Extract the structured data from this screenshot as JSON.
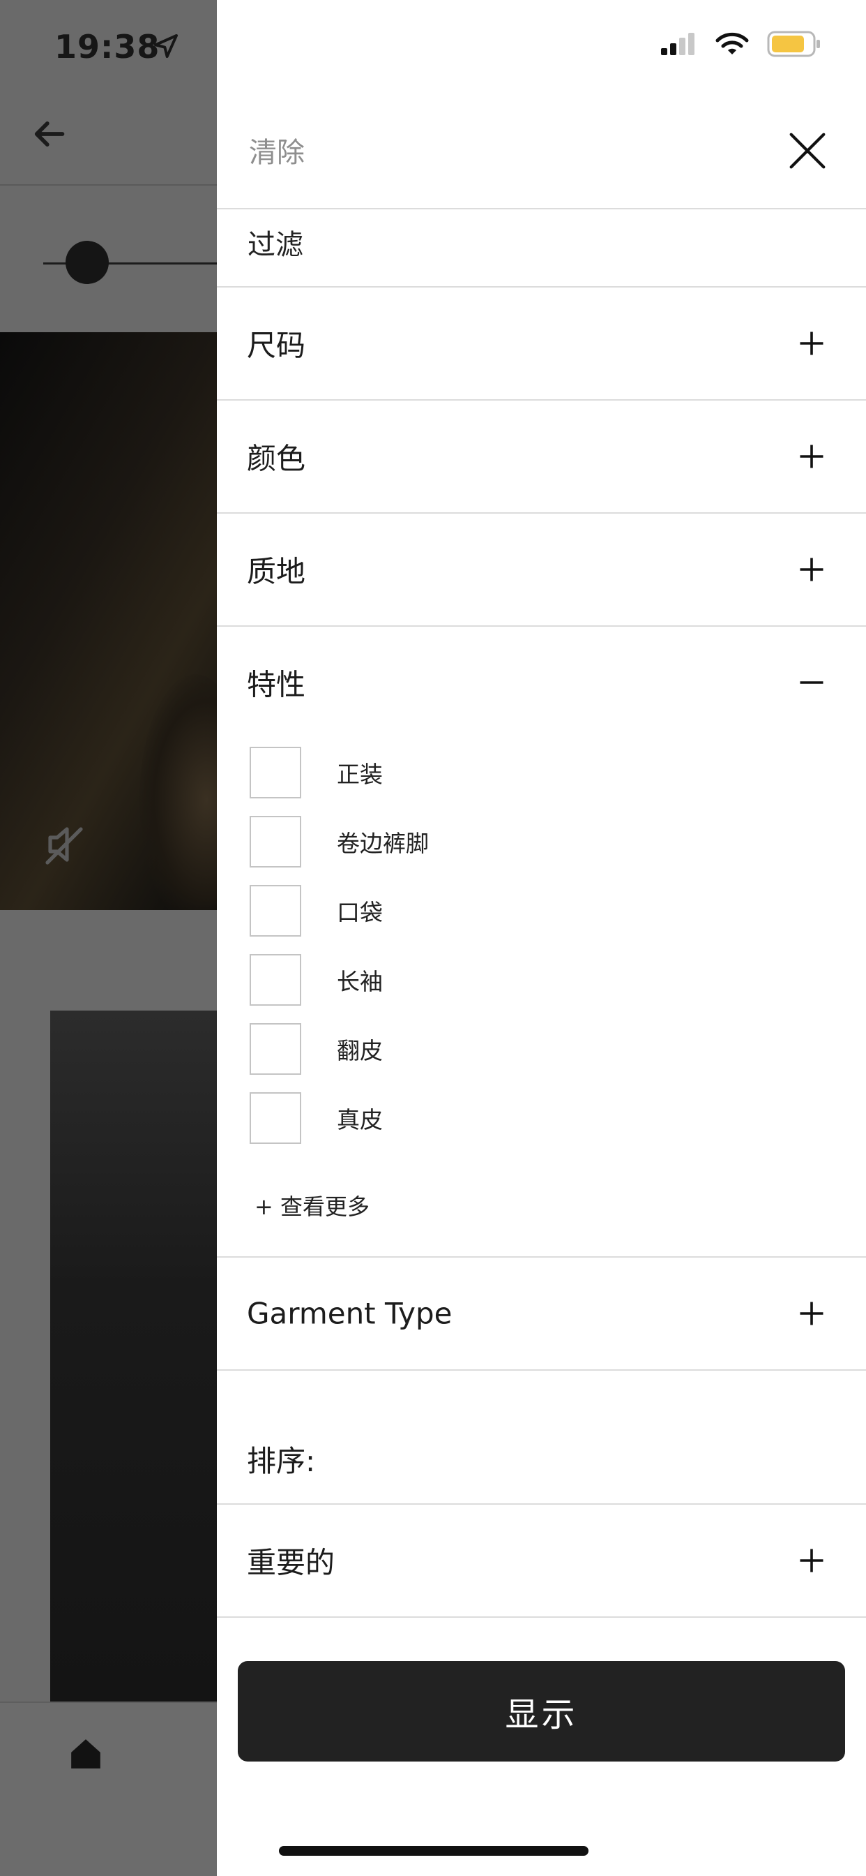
{
  "status_bar": {
    "time": "19:38"
  },
  "panel": {
    "clear_label": "清除",
    "filter_title": "过滤",
    "sections": [
      {
        "label": "尺码",
        "state": "collapsed"
      },
      {
        "label": "颜色",
        "state": "collapsed"
      },
      {
        "label": "质地",
        "state": "collapsed"
      },
      {
        "label": "特性",
        "state": "expanded"
      }
    ],
    "feature_options": [
      {
        "label": "正装",
        "checked": false
      },
      {
        "label": "卷边裤脚",
        "checked": false
      },
      {
        "label": "口袋",
        "checked": false
      },
      {
        "label": "长袖",
        "checked": false
      },
      {
        "label": "翻皮",
        "checked": false
      },
      {
        "label": "真皮",
        "checked": false
      }
    ],
    "see_more_label": "+ 查看更多",
    "garment_type_label": "Garment Type",
    "sort_title": "排序:",
    "sort_option_label": "重要的",
    "show_button_label": "显示"
  },
  "icons": {
    "close": "close-icon",
    "plus": "plus-icon",
    "minus": "minus-icon",
    "back": "arrow-left-icon",
    "mute": "mute-icon",
    "home": "home-icon",
    "location": "location-arrow-icon",
    "signal": "cellular-signal-icon",
    "wifi": "wifi-icon",
    "battery": "battery-icon"
  },
  "colors": {
    "overlay": "#6a6a6a",
    "panel_bg": "#ffffff",
    "divider": "#dcdcdc",
    "button_bg": "#222222",
    "battery_fill": "#f5c542"
  }
}
